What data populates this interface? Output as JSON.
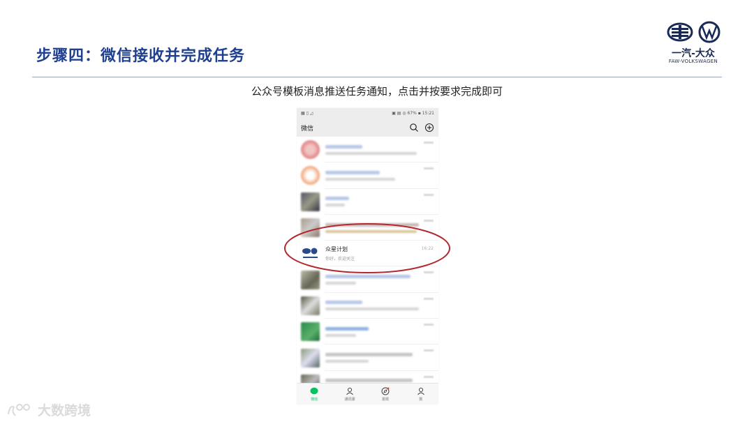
{
  "slide": {
    "title": "步骤四：微信接收并完成任务",
    "subtitle": "公众号模板消息推送任务通知，点击并按要求完成即可"
  },
  "logo": {
    "brand_text": "一汽-大众",
    "sub_text": "FAW-VOLKSWAGEN",
    "color": "#1a2a55"
  },
  "phone": {
    "app_title": "微信",
    "status_right": "▣ ▤ ◎ 67% ▪ 15:21",
    "highlighted_chat": {
      "name": "众星计划",
      "message": "你好，欢迎关注",
      "time": "16:22"
    },
    "tabs": [
      {
        "label": "微信",
        "icon": "chat-bubble-icon",
        "active": true
      },
      {
        "label": "通讯录",
        "icon": "contacts-icon",
        "active": false
      },
      {
        "label": "发现",
        "icon": "compass-icon",
        "active": false
      },
      {
        "label": "我",
        "icon": "person-icon",
        "active": false
      }
    ]
  },
  "watermark": {
    "text": "大数跨境"
  },
  "colors": {
    "title": "#1f3f8f",
    "highlight_ellipse": "#b3282d",
    "wechat_green": "#07c160"
  }
}
